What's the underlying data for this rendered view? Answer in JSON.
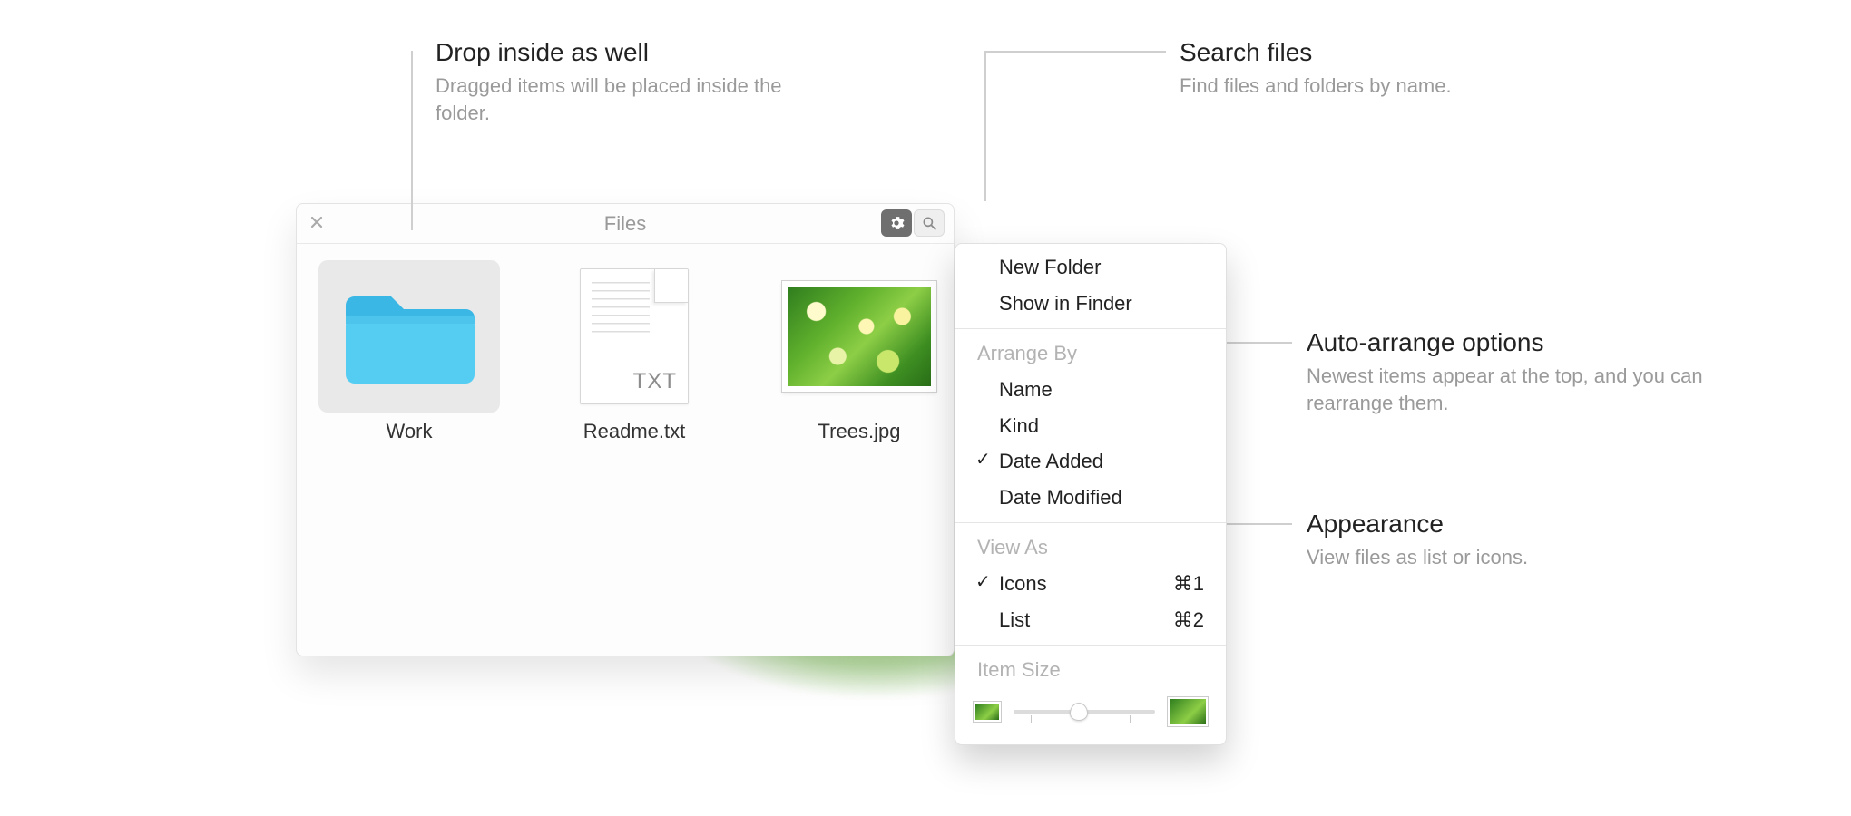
{
  "callouts": {
    "drop": {
      "title": "Drop inside as well",
      "desc": "Dragged items will be placed inside the folder."
    },
    "search": {
      "title": "Search files",
      "desc": "Find files and folders by name."
    },
    "arrange": {
      "title": "Auto-arrange options",
      "desc": "Newest items appear at the top, and you can rearrange them."
    },
    "appear": {
      "title": "Appearance",
      "desc": "View files as list or icons."
    }
  },
  "window": {
    "title": "Files"
  },
  "files": [
    {
      "name": "Work",
      "kind": "folder",
      "selected": true
    },
    {
      "name": "Readme.txt",
      "kind": "txt",
      "ext": "TXT"
    },
    {
      "name": "Trees.jpg",
      "kind": "image"
    }
  ],
  "menu": {
    "new_folder": "New Folder",
    "show_in_finder": "Show in Finder",
    "arrange_by_header": "Arrange By",
    "arrange_by": [
      {
        "label": "Name",
        "checked": false
      },
      {
        "label": "Kind",
        "checked": false
      },
      {
        "label": "Date Added",
        "checked": true
      },
      {
        "label": "Date Modified",
        "checked": false
      }
    ],
    "view_as_header": "View As",
    "view_as": [
      {
        "label": "Icons",
        "shortcut": "⌘1",
        "checked": true
      },
      {
        "label": "List",
        "shortcut": "⌘2",
        "checked": false
      }
    ],
    "item_size_header": "Item Size"
  }
}
